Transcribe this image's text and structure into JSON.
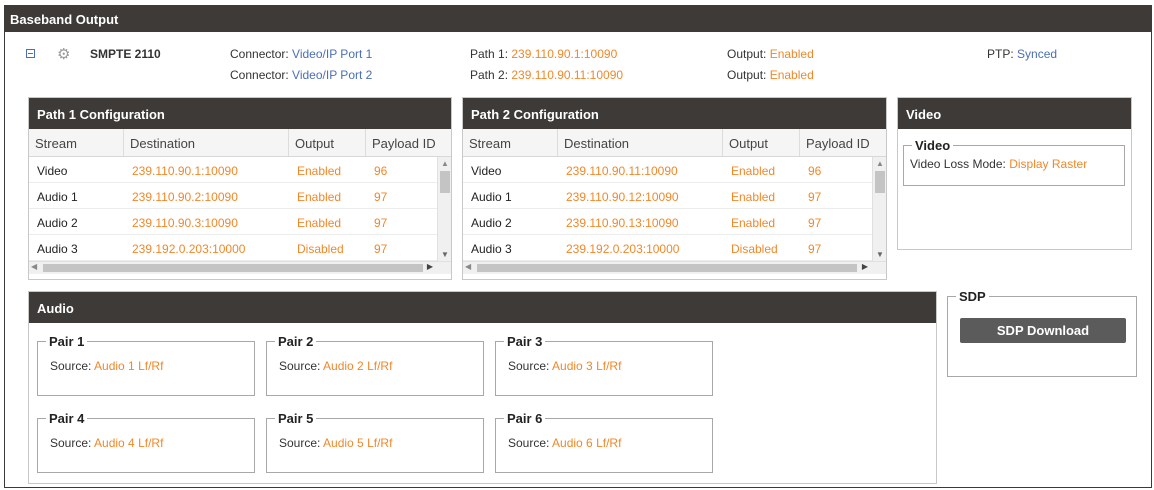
{
  "title": "Baseband Output",
  "summary": {
    "format": "SMPTE 2110",
    "connector_label": "Connector:",
    "connector1": "Video/IP Port 1",
    "connector2": "Video/IP Port 2",
    "path1_label": "Path 1:",
    "path1": "239.110.90.1:10090",
    "path2_label": "Path 2:",
    "path2": "239.110.90.11:10090",
    "output_label": "Output:",
    "output1": "Enabled",
    "output2": "Enabled",
    "ptp_label": "PTP:",
    "ptp": "Synced"
  },
  "path1": {
    "title": "Path 1 Configuration",
    "columns": [
      "Stream",
      "Destination",
      "Output",
      "Payload ID"
    ],
    "rows": [
      [
        "Video",
        "239.110.90.1:10090",
        "Enabled",
        "96"
      ],
      [
        "Audio 1",
        "239.110.90.2:10090",
        "Enabled",
        "97"
      ],
      [
        "Audio 2",
        "239.110.90.3:10090",
        "Enabled",
        "97"
      ],
      [
        "Audio 3",
        "239.192.0.203:10000",
        "Disabled",
        "97"
      ]
    ]
  },
  "path2": {
    "title": "Path 2 Configuration",
    "columns": [
      "Stream",
      "Destination",
      "Output",
      "Payload ID"
    ],
    "rows": [
      [
        "Video",
        "239.110.90.11:10090",
        "Enabled",
        "96"
      ],
      [
        "Audio 1",
        "239.110.90.12:10090",
        "Enabled",
        "97"
      ],
      [
        "Audio 2",
        "239.110.90.13:10090",
        "Enabled",
        "97"
      ],
      [
        "Audio 3",
        "239.192.0.203:10000",
        "Disabled",
        "97"
      ]
    ]
  },
  "video": {
    "title": "Video",
    "legend": "Video",
    "loss_label": "Video Loss Mode:",
    "loss_value": "Display Raster"
  },
  "audio": {
    "title": "Audio",
    "source_label": "Source:",
    "pairs": [
      {
        "name": "Pair 1",
        "source": "Audio 1 Lf/Rf"
      },
      {
        "name": "Pair 2",
        "source": "Audio 2 Lf/Rf"
      },
      {
        "name": "Pair 3",
        "source": "Audio 3 Lf/Rf"
      },
      {
        "name": "Pair 4",
        "source": "Audio 4 Lf/Rf"
      },
      {
        "name": "Pair 5",
        "source": "Audio 5 Lf/Rf"
      },
      {
        "name": "Pair 6",
        "source": "Audio 6 Lf/Rf"
      }
    ]
  },
  "sdp": {
    "legend": "SDP",
    "button": "SDP Download"
  },
  "colors": {
    "header_bg": "#3d3a37",
    "value_orange": "#f0882a",
    "link_blue": "#4a6fb5"
  }
}
